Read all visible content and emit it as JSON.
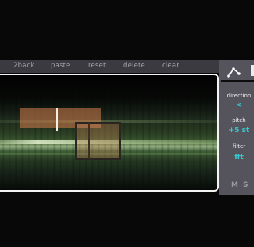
{
  "toolbar": {
    "buttons": [
      {
        "id": "2back",
        "label": "2back"
      },
      {
        "id": "paste",
        "label": "paste"
      },
      {
        "id": "reset",
        "label": "reset"
      },
      {
        "id": "delete",
        "label": "delete"
      },
      {
        "id": "clear",
        "label": "clear"
      }
    ]
  },
  "panel": {
    "curve_icon": "curve-tool-icon",
    "direction": {
      "label": "direction",
      "value": "<"
    },
    "pitch": {
      "label": "pitch",
      "value": "+5 st"
    },
    "filter": {
      "label": "filter",
      "value": "fft"
    },
    "mute_label": "M",
    "solo_label": "S"
  },
  "colors": {
    "accent": "#38c7cf",
    "toolbar_bg": "#3b3a40",
    "panel_bg": "#55545c",
    "region": "#d5804e"
  }
}
